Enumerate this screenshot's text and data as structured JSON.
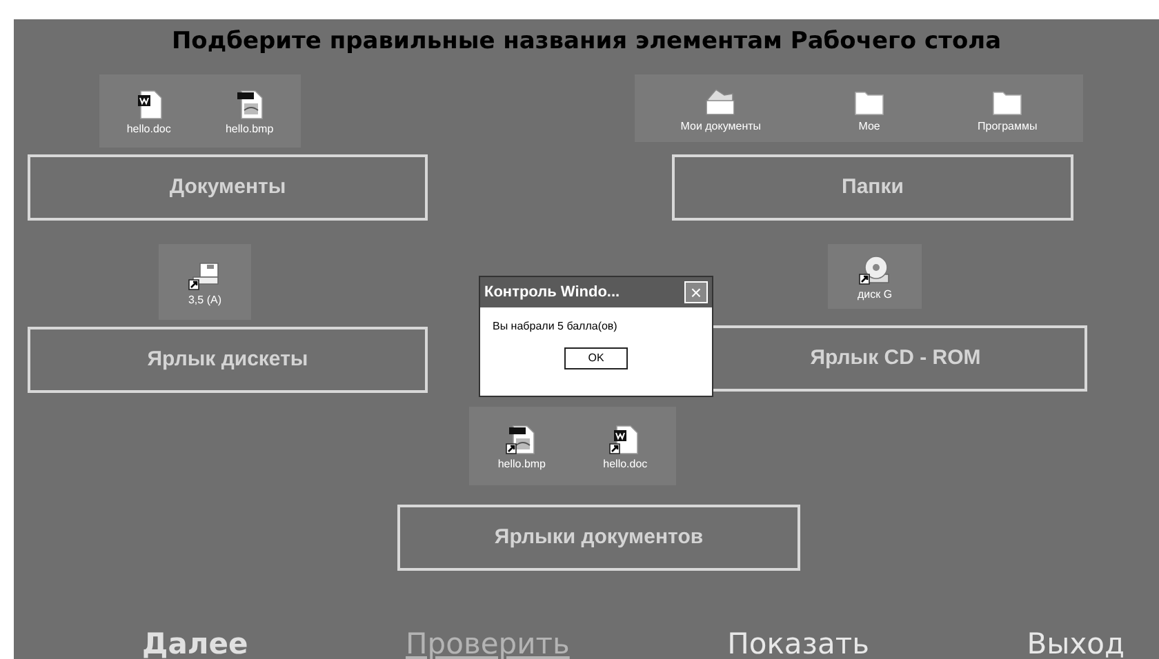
{
  "title": "Подберите правильные названия элементам Рабочего стола",
  "icon_groups": [
    {
      "icons": [
        {
          "kind": "doc",
          "label": "hello.doc",
          "shortcut": false
        },
        {
          "kind": "bmp",
          "label": "hello.bmp",
          "shortcut": false
        }
      ]
    },
    {
      "icons": [
        {
          "kind": "mydocs",
          "label": "Мои документы",
          "shortcut": false
        },
        {
          "kind": "folder",
          "label": "Мое",
          "shortcut": false
        },
        {
          "kind": "folder",
          "label": "Программы",
          "shortcut": false
        }
      ]
    },
    {
      "icons": [
        {
          "kind": "floppy",
          "label": "3,5 (A)",
          "shortcut": true
        }
      ]
    },
    {
      "icons": [
        {
          "kind": "cd",
          "label": "диск G",
          "shortcut": true
        }
      ]
    },
    {
      "icons": [
        {
          "kind": "bmp",
          "label": "hello.bmp",
          "shortcut": true
        },
        {
          "kind": "doc",
          "label": "hello.doc",
          "shortcut": true
        }
      ]
    }
  ],
  "answer_boxes": [
    {
      "label": "Документы"
    },
    {
      "label": "Папки"
    },
    {
      "label": "Ярлык дискеты"
    },
    {
      "label": "Ярлык CD - ROM"
    },
    {
      "label": "Ярлыки документов"
    }
  ],
  "dialog": {
    "title": "Контроль Windo...",
    "close": "×",
    "message": "Вы набрали 5 балла(ов)",
    "button": "OK"
  },
  "nav": [
    {
      "label": "Далее",
      "underlined": false
    },
    {
      "label": "Проверить",
      "underlined": true
    },
    {
      "label": "Показать",
      "underlined": false
    },
    {
      "label": "Выход",
      "underlined": false
    }
  ]
}
